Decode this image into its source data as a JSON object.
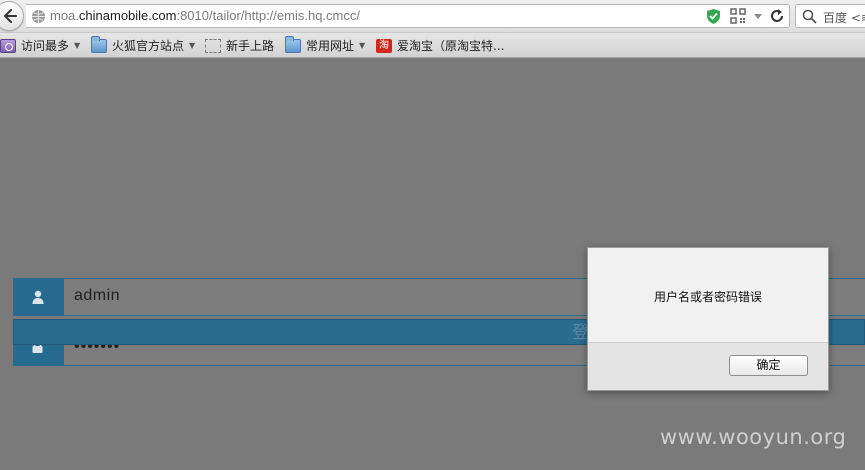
{
  "browser": {
    "url_prefix": "moa.",
    "url_host": "chinamobile.com",
    "url_rest": ":8010/tailor/http://emis.hq.cmcc/",
    "search_text": "百度 <≋"
  },
  "bookmarks": [
    {
      "label": "访问最多",
      "icon": "most-visited-icon",
      "has_caret": true
    },
    {
      "label": "火狐官方站点",
      "icon": "folder-icon",
      "has_caret": true
    },
    {
      "label": "新手上路",
      "icon": "page-icon",
      "has_caret": false
    },
    {
      "label": "常用网址",
      "icon": "folder-icon",
      "has_caret": true
    },
    {
      "label": "爱淘宝（原淘宝特...",
      "icon": "taobao-icon",
      "has_caret": false
    }
  ],
  "login": {
    "username_value": "admin",
    "password_value": "•••••••",
    "submit_label": "登录"
  },
  "alert": {
    "message": "用户名或者密码错误",
    "ok_label": "确定"
  },
  "watermark": "www.wooyun.org",
  "colors": {
    "accent": "#266a90",
    "page_bg": "#7a7a7a"
  }
}
